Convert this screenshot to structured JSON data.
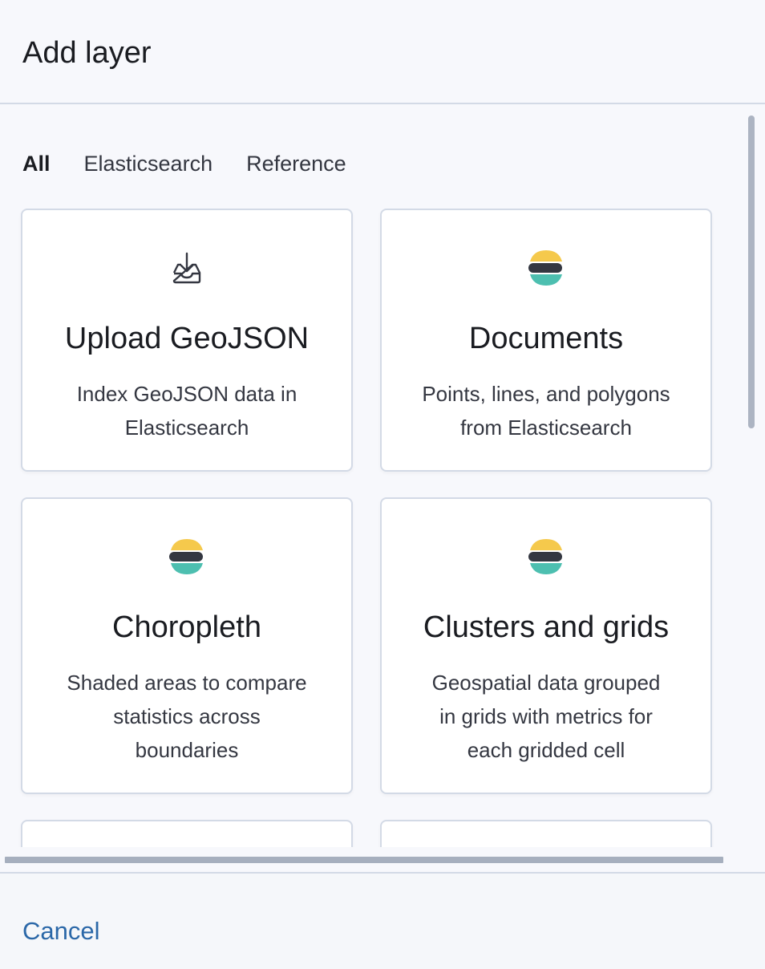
{
  "header": {
    "title": "Add layer"
  },
  "tabs": [
    {
      "label": "All",
      "active": true
    },
    {
      "label": "Elasticsearch",
      "active": false
    },
    {
      "label": "Reference",
      "active": false
    }
  ],
  "cards": [
    {
      "title": "Upload GeoJSON",
      "desc_line1": "Index GeoJSON data in",
      "desc_line2": "Elasticsearch",
      "desc_line3": "",
      "icon": "upload-icon"
    },
    {
      "title": "Documents",
      "desc_line1": "Points, lines, and polygons",
      "desc_line2": "from Elasticsearch",
      "desc_line3": "",
      "icon": "elasticsearch-logo-icon"
    },
    {
      "title": "Choropleth",
      "desc_line1": "Shaded areas to compare",
      "desc_line2": "statistics across",
      "desc_line3": "boundaries",
      "icon": "elasticsearch-logo-icon"
    },
    {
      "title": "Clusters and grids",
      "desc_line1": "Geospatial data grouped",
      "desc_line2": "in grids with metrics for",
      "desc_line3": "each gridded cell",
      "icon": "elasticsearch-logo-icon"
    }
  ],
  "footer": {
    "cancel_label": "Cancel"
  },
  "colors": {
    "logo_yellow": "#f5c94c",
    "logo_dark": "#343741",
    "logo_teal": "#4dbfb0",
    "link_blue": "#2b68a8"
  }
}
